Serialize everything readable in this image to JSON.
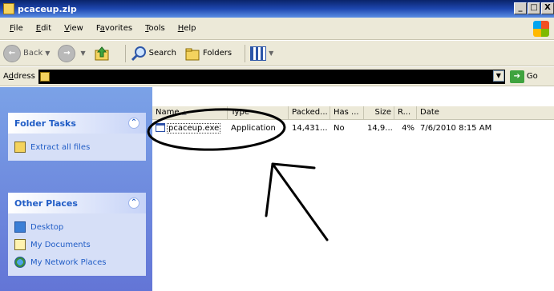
{
  "window": {
    "title": "pcaceup.zip",
    "controls": {
      "minimize": "_",
      "maximize": "□",
      "close": "X"
    }
  },
  "menubar": {
    "items": [
      {
        "label_u": "F",
        "label_rest": "ile"
      },
      {
        "label_u": "E",
        "label_rest": "dit"
      },
      {
        "label_u": "V",
        "label_rest": "iew"
      },
      {
        "label_pre": "F",
        "label_u": "a",
        "label_rest": "vorites"
      },
      {
        "label_u": "T",
        "label_rest": "ools"
      },
      {
        "label_u": "H",
        "label_rest": "elp"
      }
    ]
  },
  "toolbar": {
    "back_label": "Back",
    "search_label": "Search",
    "folders_label": "Folders"
  },
  "address": {
    "label_pre": "A",
    "label_u": "d",
    "label_rest": "dress",
    "go_label": "Go"
  },
  "taskpane": {
    "folder_tasks": {
      "title": "Folder Tasks",
      "items": [
        {
          "label": "Extract all files",
          "icon": "extract-icon"
        }
      ]
    },
    "other_places": {
      "title": "Other Places",
      "items": [
        {
          "label": "Desktop",
          "icon": "desktop-icon"
        },
        {
          "label": "My Documents",
          "icon": "my-documents-icon"
        },
        {
          "label": "My Network Places",
          "icon": "network-places-icon"
        }
      ]
    }
  },
  "filelist": {
    "columns": [
      "Name",
      "Type",
      "Packed...",
      "Has ...",
      "Size",
      "R...",
      "Date"
    ],
    "sort_indicator": "▲",
    "rows": [
      {
        "name": "pcaceup.exe",
        "type": "Application",
        "packed": "14,431...",
        "has": "No",
        "size": "14,9...",
        "ratio": "4%",
        "date": "7/6/2010 8:15 AM"
      }
    ]
  },
  "colors": {
    "title_bar": "#1e47b0",
    "task_pane_bg": "#7ba2e7",
    "panel_title": "#215dc6",
    "chrome": "#ece9d8"
  }
}
